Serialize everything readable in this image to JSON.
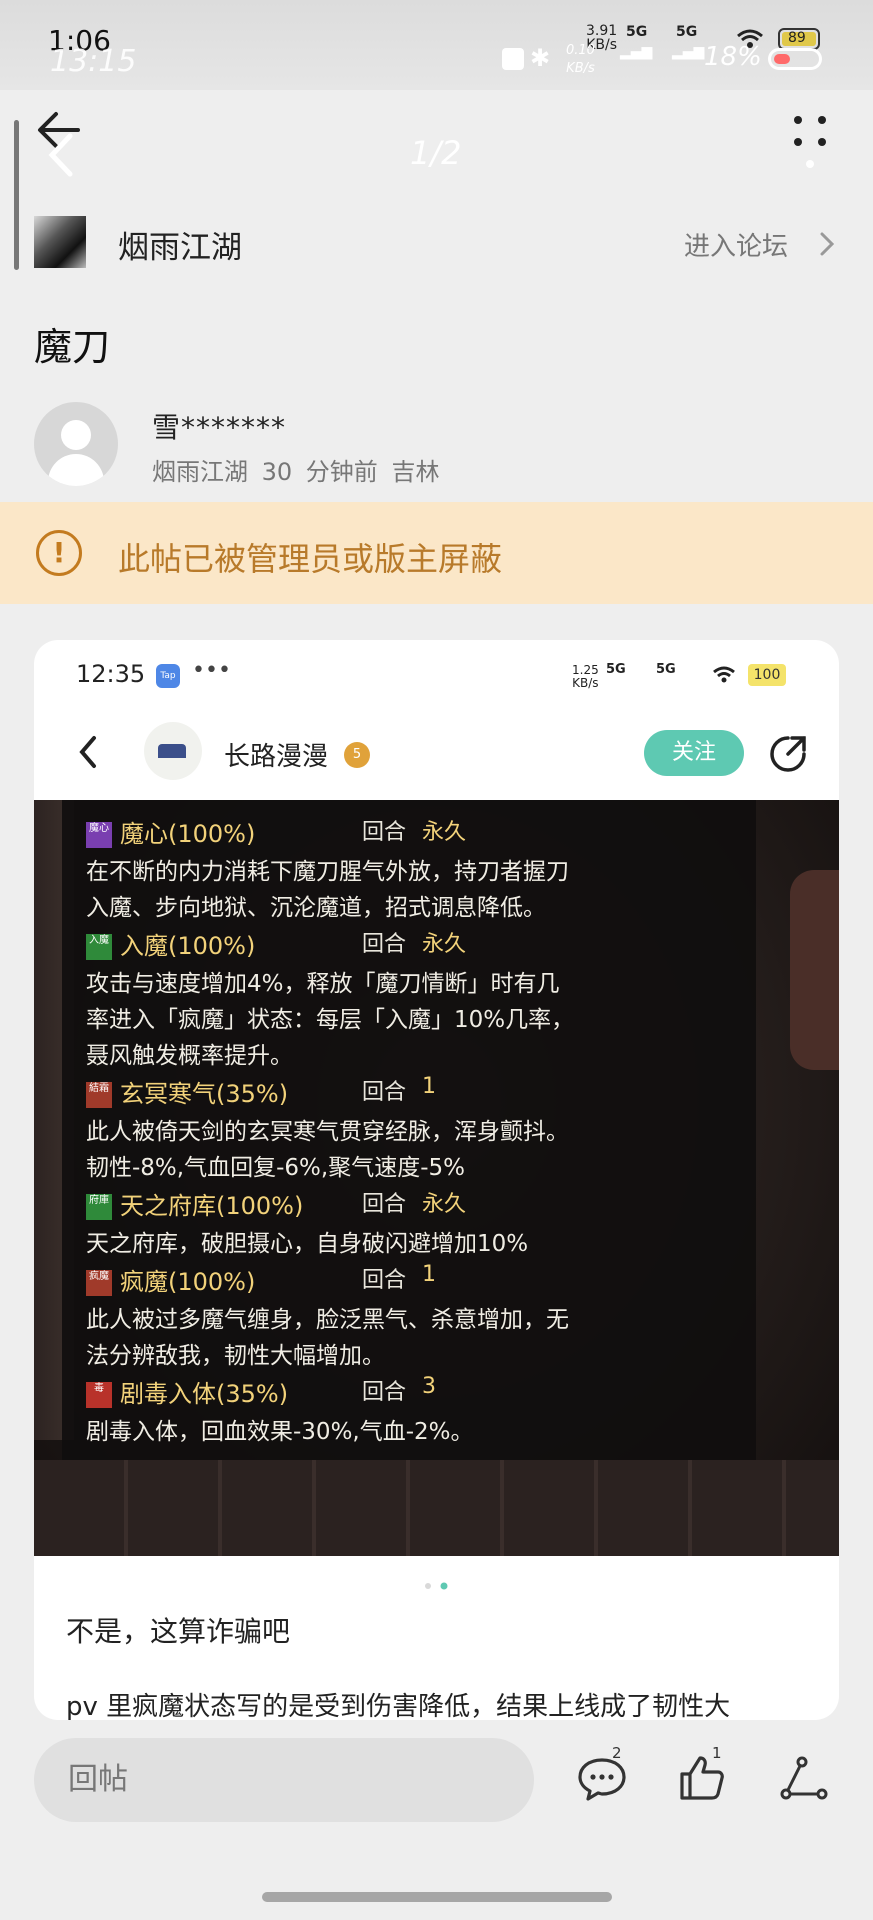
{
  "status_bar": {
    "time": "1:06",
    "time_ghost": "13:15",
    "speed_top": "3.91",
    "speed_unit": "KB/s",
    "speed_ghost": "0.10",
    "speed_ghost_unit": "KB/s",
    "signal_1": "5G",
    "signal_2": "5G",
    "battery": "89",
    "battery_ghost": "18%"
  },
  "nav": {
    "page_indicator": "1/2"
  },
  "forum": {
    "name": "烟雨江湖",
    "enter_label": "进入论坛"
  },
  "post": {
    "title": "魔刀",
    "author_name": "雪*******",
    "author_forum": "烟雨江湖",
    "time_ago": "30 分钟前",
    "location": "吉林",
    "notice": "此帖已被管理员或版主屏蔽",
    "body_line_1": "不是，这算诈骗吧",
    "body_line_2": "pv 里疯魔状态写的是受到伤害降低，结果上线成了韧性大"
  },
  "inner_screenshot": {
    "time": "12:35",
    "app_badge": "Tap",
    "speed": "1.25",
    "speed_unit": "KB/s",
    "signal_1": "5G",
    "signal_2": "5G",
    "battery": "100",
    "username": "长路漫漫",
    "level": "5",
    "follow_label": "关注"
  },
  "buffs": [
    {
      "icon_text": "魔心",
      "icon_color": "#7a3fb0",
      "name": "魔心(100%)",
      "turn_label": "回合",
      "duration": "永久",
      "desc": [
        "在不断的内力消耗下魔刀腥气外放，持刀者握刀",
        "入魔、步向地狱、沉沦魔道，招式调息降低。"
      ]
    },
    {
      "icon_text": "入魔",
      "icon_color": "#2f8a3a",
      "name": "入魔(100%)",
      "turn_label": "回合",
      "duration": "永久",
      "desc": [
        "攻击与速度增加4%，释放「魔刀情断」时有几",
        "率进入「疯魔」状态：每层「入魔」10%几率，",
        "聂风触发概率提升。"
      ]
    },
    {
      "icon_text": "結霜",
      "icon_color": "#a03a2a",
      "name": "玄冥寒气(35%)",
      "turn_label": "回合",
      "duration": "1",
      "desc": [
        "此人被倚天剑的玄冥寒气贯穿经脉，浑身颤抖。",
        "韧性-8%,气血回复-6%,聚气速度-5%"
      ]
    },
    {
      "icon_text": "府庫",
      "icon_color": "#2f8a3a",
      "name": "天之府库(100%)",
      "turn_label": "回合",
      "duration": "永久",
      "desc": [
        "天之府库，破胆摄心，自身破闪避增加10%"
      ]
    },
    {
      "icon_text": "疯魔",
      "icon_color": "#a03a2a",
      "name": "疯魔(100%)",
      "turn_label": "回合",
      "duration": "1",
      "desc": [
        "此人被过多魔气缠身，脸泛黑气、杀意增加，无",
        "法分辨敌我，韧性大幅增加。"
      ]
    },
    {
      "icon_text": "毒",
      "icon_color": "#b8322a",
      "name": "剧毒入体(35%)",
      "turn_label": "回合",
      "duration": "3",
      "desc": [
        "剧毒入体，回血效果-30%,气血-2%。"
      ]
    }
  ],
  "carousel": {
    "total": 2,
    "active": 2
  },
  "bottom_bar": {
    "reply_placeholder": "回帖",
    "comment_count": "2",
    "like_count": "1"
  },
  "colors": {
    "accent_teal": "#5ec9b2",
    "notice_bg": "#fbe7c8",
    "notice_text": "#b87a2a",
    "buff_name": "#f2d27a"
  },
  "icons": [
    "back-arrow-icon",
    "more-dots-icon",
    "chevron-right-icon",
    "alert-circle-icon",
    "comment-icon",
    "thumbs-up-icon",
    "share-icon"
  ]
}
